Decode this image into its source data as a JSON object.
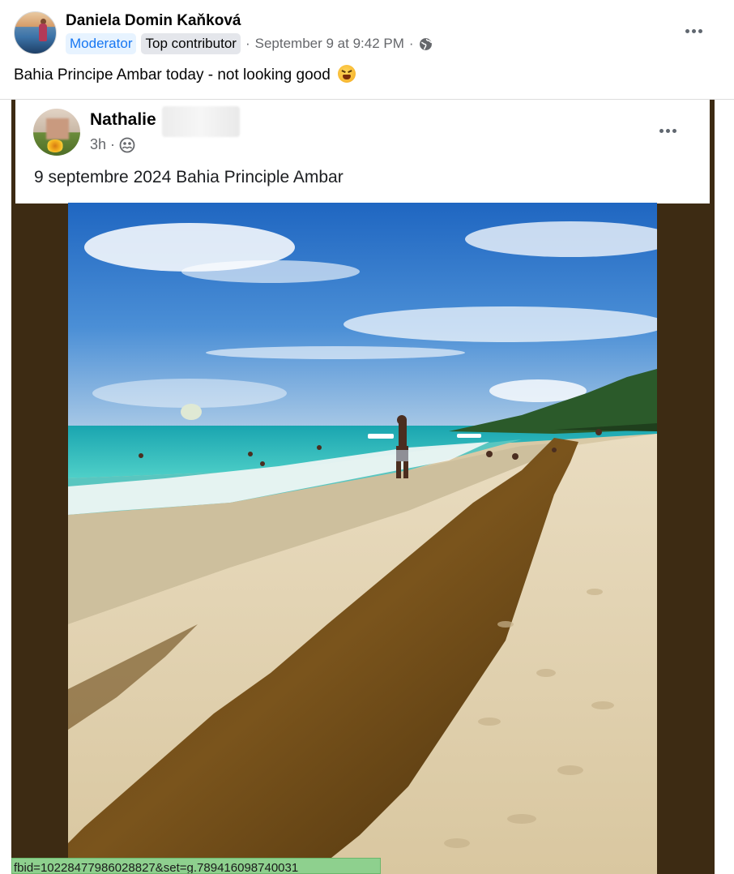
{
  "post": {
    "author": "Daniela Domin Kaňková",
    "badges": [
      "Moderator",
      "Top contributor"
    ],
    "timestamp": "September 9 at 9:42 PM",
    "separator": "·",
    "text": "Bahia Principe Ambar today - not looking good",
    "emoji": "tired-face-emoji",
    "more_icon": "more-options-icon",
    "privacy_icon": "globe-icon"
  },
  "shared": {
    "author": "Nathalie",
    "time": "3h",
    "separator": "·",
    "audience_icon": "group-icon",
    "text": "9 septembre 2024 Bahia Principle Ambar",
    "more_icon": "more-options-icon"
  },
  "photo": {
    "subject": "beach-with-seaweed-photo"
  },
  "status_url": "fbid=10228477986028827&set=g.789416098740031",
  "colors": {
    "link_blue": "#1877f2",
    "meta_gray": "#65676b",
    "dark_band": "#3d2b13",
    "tooltip_green": "#8ed08e"
  }
}
